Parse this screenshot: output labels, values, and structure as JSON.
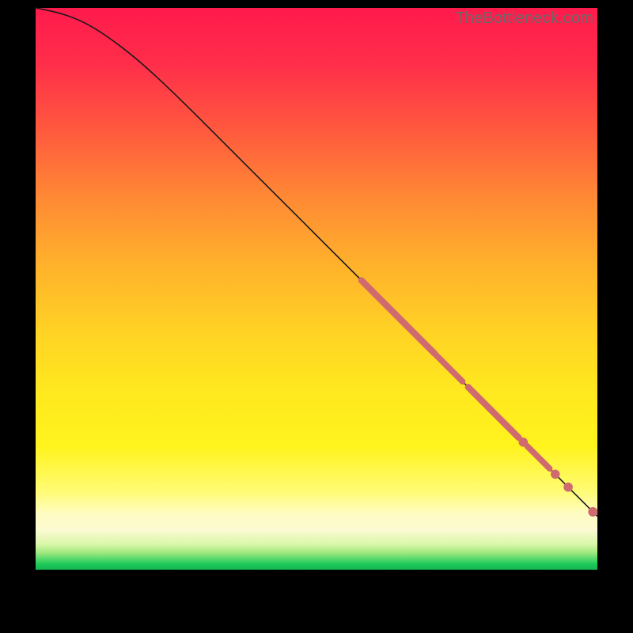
{
  "watermark": "TheBottleneck.com",
  "chart_data": {
    "type": "line",
    "title": "",
    "xlabel": "",
    "ylabel": "",
    "xlim": [
      0,
      100
    ],
    "ylim": [
      0,
      100
    ],
    "grid": false,
    "legend": false,
    "curve": [
      {
        "x": 0,
        "y": 100
      },
      {
        "x": 4,
        "y": 99.2
      },
      {
        "x": 8,
        "y": 97.8
      },
      {
        "x": 12,
        "y": 95.5
      },
      {
        "x": 18,
        "y": 91.0
      },
      {
        "x": 25,
        "y": 84.5
      },
      {
        "x": 35,
        "y": 74.5
      },
      {
        "x": 45,
        "y": 64.5
      },
      {
        "x": 55,
        "y": 54.5
      },
      {
        "x": 65,
        "y": 44.5
      },
      {
        "x": 75,
        "y": 34.5
      },
      {
        "x": 85,
        "y": 24.5
      },
      {
        "x": 92,
        "y": 17.5
      },
      {
        "x": 100,
        "y": 9.5
      }
    ],
    "highlight_segments": [
      {
        "x0": 58,
        "y0": 51.5,
        "x1": 71,
        "y1": 38.5,
        "thickness": 4.2
      },
      {
        "x0": 71,
        "y0": 38.5,
        "x1": 76,
        "y1": 33.5,
        "thickness": 3.6
      },
      {
        "x0": 77,
        "y0": 32.5,
        "x1": 86,
        "y1": 23.5,
        "thickness": 4.2
      },
      {
        "x0": 87.5,
        "y0": 22.0,
        "x1": 91.5,
        "y1": 18.0,
        "thickness": 3.6
      }
    ],
    "dots": [
      {
        "x": 86.8,
        "y": 22.7,
        "r": 3.2
      },
      {
        "x": 92.5,
        "y": 17.0,
        "r": 3.2
      },
      {
        "x": 94.8,
        "y": 14.7,
        "r": 3.2
      },
      {
        "x": 99.2,
        "y": 10.3,
        "r": 3.4
      }
    ],
    "colors": {
      "curve": "#1a1a1a",
      "highlight": "#cf6a6f",
      "dot": "#cf6a6f"
    }
  }
}
